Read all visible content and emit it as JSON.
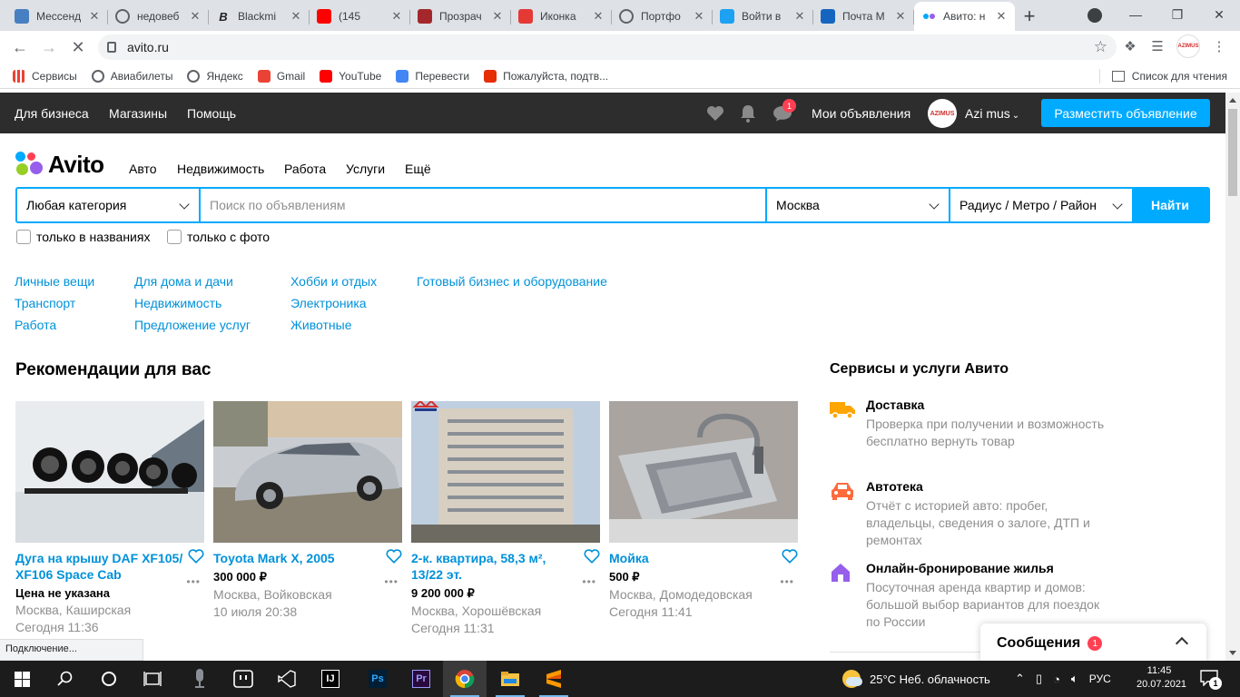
{
  "browser": {
    "tabs": [
      {
        "title": "Мессенд",
        "icon": "vk-messenger-icon",
        "color": "#4680c2",
        "glyph": ""
      },
      {
        "title": "недовеб",
        "icon": "globe-icon",
        "color": "#5f6368",
        "glyph": ""
      },
      {
        "title": "Blackmi",
        "icon": "behance-icon",
        "color": "#202124",
        "glyph": "B"
      },
      {
        "title": "(145",
        "icon": "youtube-icon",
        "color": "#ff0000",
        "glyph": ""
      },
      {
        "title": "Прозрач",
        "icon": "opera-icon",
        "color": "#a4282b",
        "glyph": ""
      },
      {
        "title": "Иконка",
        "icon": "icon-site-icon",
        "color": "#e53935",
        "glyph": ""
      },
      {
        "title": "Портфо",
        "icon": "globe-icon",
        "color": "#5f6368",
        "glyph": ""
      },
      {
        "title": "Войти в",
        "icon": "twitter-icon",
        "color": "#1da1f2",
        "glyph": ""
      },
      {
        "title": "Почта М",
        "icon": "mail-icon",
        "color": "#1565c0",
        "glyph": ""
      },
      {
        "title": "Авито: н",
        "icon": "avito-icon",
        "color": "#ffffff",
        "glyph": ""
      }
    ],
    "url": "avito.ru",
    "profile_text": "AZIMUS",
    "bookmarks": [
      {
        "label": "Сервисы",
        "icon": "apps-icon",
        "color": "#4285f4"
      },
      {
        "label": "Авиабилеты",
        "icon": "globe-icon",
        "color": "#5f6368"
      },
      {
        "label": "Яндекс",
        "icon": "globe-icon",
        "color": "#5f6368"
      },
      {
        "label": "Gmail",
        "icon": "gmail-icon",
        "color": "#ea4335"
      },
      {
        "label": "YouTube",
        "icon": "youtube-icon",
        "color": "#ff0000"
      },
      {
        "label": "Перевести",
        "icon": "translate-icon",
        "color": "#4285f4"
      },
      {
        "label": "Пожалуйста, подтв...",
        "icon": "aliexpress-icon",
        "color": "#e62e04"
      }
    ],
    "reading_list": "Список для чтения",
    "status_text": "Подключение..."
  },
  "avito": {
    "topbar": {
      "links": [
        "Для бизнеса",
        "Магазины",
        "Помощь"
      ],
      "message_badge": "1",
      "my_ads": "Мои объявления",
      "avatar_text": "AZIMUS",
      "username": "Azi mus",
      "post_button": "Разместить объявление"
    },
    "logo": "Avito",
    "nav": [
      "Авто",
      "Недвижимость",
      "Работа",
      "Услуги",
      "Ещё"
    ],
    "search": {
      "category": "Любая категория",
      "placeholder": "Поиск по объявлениям",
      "city": "Москва",
      "radius": "Радиус / Метро / Район",
      "button": "Найти"
    },
    "checkboxes": [
      "только в названиях",
      "только с фото"
    ],
    "categories": [
      [
        "Личные вещи",
        "Транспорт",
        "Работа"
      ],
      [
        "Для дома и дачи",
        "Недвижимость",
        "Предложение услуг"
      ],
      [
        "Хобби и отдых",
        "Электроника",
        "Животные"
      ],
      [
        "Готовый бизнес и оборудование"
      ]
    ],
    "reco_title": "Рекомендации для вас",
    "cards": [
      {
        "title": "Дуга на крышу DAF XF105/ XF106 Space Cab",
        "price": "Цена не указана",
        "location": "Москва, Каширская",
        "date": "Сегодня 11:36"
      },
      {
        "title": "Toyota Mark X, 2005",
        "price": "300 000 ₽",
        "location": "Москва, Войковская",
        "date": "10 июля 20:38"
      },
      {
        "title": "2-к. квартира, 58,3 м², 13/22 эт.",
        "price": "9 200 000 ₽",
        "location": "Москва, Хорошёвская",
        "date": "Сегодня 11:31"
      },
      {
        "title": "Мойка",
        "price": "500 ₽",
        "location": "Москва, Домодедовская",
        "date": "Сегодня 11:41"
      }
    ],
    "services_title": "Сервисы и услуги Авито",
    "services": [
      {
        "title": "Доставка",
        "desc": "Проверка при получении и возможность бесплатно вернуть товар",
        "icon": "truck-icon",
        "color": "#ffa500"
      },
      {
        "title": "Автотека",
        "desc": "Отчёт с историей авто: пробег, владельцы, сведения о залоге, ДТП и ремонтах",
        "icon": "car-icon",
        "color": "#ff6a3d"
      },
      {
        "title": "Онлайн-бронирование жилья",
        "desc": "Посуточная аренда квартир и домов: большой выбор вариантов для поездок по России",
        "icon": "house-icon",
        "color": "#965eeb"
      }
    ],
    "messages_panel": {
      "label": "Сообщения",
      "badge": "1"
    }
  },
  "taskbar": {
    "weather": "25°C  Неб. облачность",
    "lang": "РУС",
    "time": "11:45",
    "date": "20.07.2021",
    "notifications": "1",
    "apps": [
      {
        "icon": "windows-start-icon"
      },
      {
        "icon": "search-icon"
      },
      {
        "icon": "cortana-icon"
      },
      {
        "icon": "task-view-icon"
      },
      {
        "icon": "microphone-app-icon"
      },
      {
        "icon": "notepad-app-icon"
      },
      {
        "icon": "visual-studio-icon"
      },
      {
        "icon": "intellij-icon"
      },
      {
        "icon": "photoshop-icon"
      },
      {
        "icon": "premiere-icon"
      },
      {
        "icon": "chrome-icon"
      },
      {
        "icon": "file-explorer-icon"
      },
      {
        "icon": "sublime-text-icon"
      }
    ]
  }
}
